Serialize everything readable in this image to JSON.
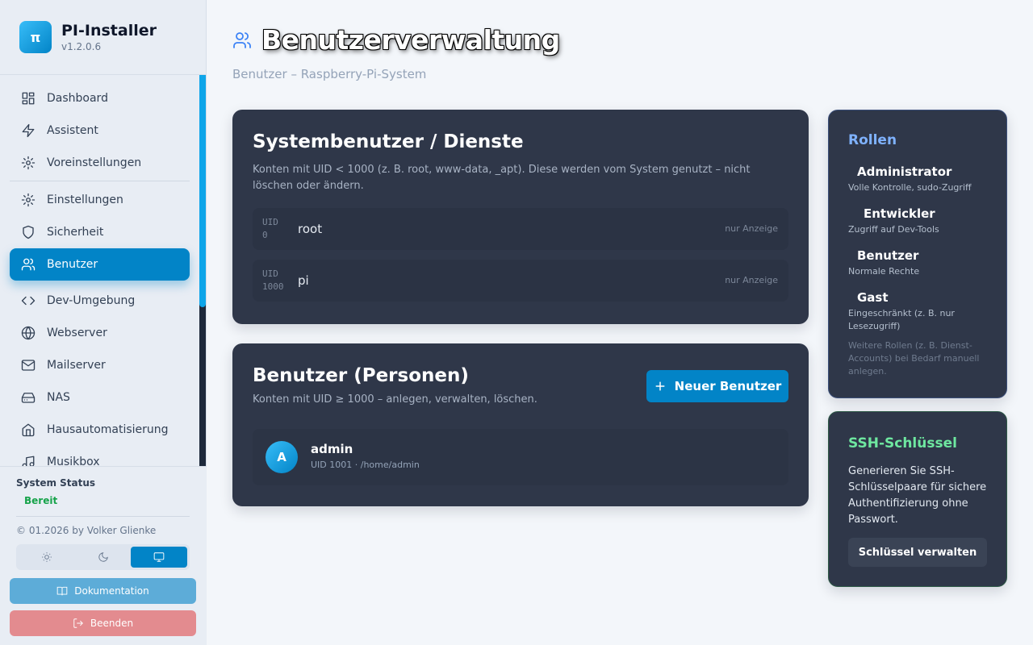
{
  "app": {
    "name": "PI-Installer",
    "version": "v1.2.0.6",
    "logo_glyph": "π"
  },
  "nav": [
    {
      "label": "Dashboard",
      "icon": "dashboard-icon"
    },
    {
      "label": "Assistent",
      "icon": "lightning-icon"
    },
    {
      "label": "Voreinstellungen",
      "icon": "gear-icon"
    },
    {
      "label": "Einstellungen",
      "icon": "gear-icon"
    },
    {
      "label": "Sicherheit",
      "icon": "shield-icon"
    },
    {
      "label": "Benutzer",
      "icon": "users-icon",
      "active": true
    },
    {
      "label": "Dev-Umgebung",
      "icon": "code-icon"
    },
    {
      "label": "Webserver",
      "icon": "globe-icon"
    },
    {
      "label": "Mailserver",
      "icon": "mail-icon"
    },
    {
      "label": "NAS",
      "icon": "hard-drive-icon"
    },
    {
      "label": "Hausautomatisierung",
      "icon": "home-icon"
    },
    {
      "label": "Musikbox",
      "icon": "music-icon"
    }
  ],
  "status": {
    "title": "System Status",
    "value": "Bereit",
    "value_color": "#16a34a"
  },
  "footer": {
    "copyright": "© 01.2026 by Volker Glienke",
    "doc_label": "Dokumentation",
    "exit_label": "Beenden"
  },
  "theme": {
    "options": [
      "light",
      "dark",
      "system"
    ],
    "selected": "system"
  },
  "page": {
    "title": "Benutzerverwaltung",
    "subtitle": "Benutzer – Raspberry-Pi-System"
  },
  "system_users": {
    "title": "Systembenutzer / Dienste",
    "description": "Konten mit UID < 1000 (z. B. root, www-data, _apt). Diese werden vom System genutzt – nicht löschen oder ändern.",
    "uid_label": "UID",
    "rows": [
      {
        "uid": "0",
        "name": "root",
        "note": "nur Anzeige"
      },
      {
        "uid": "1000",
        "name": "pi",
        "note": "nur Anzeige"
      }
    ]
  },
  "persons": {
    "title": "Benutzer (Personen)",
    "description": "Konten mit UID ≥ 1000 – anlegen, verwalten, löschen.",
    "new_button": "Neuer Benutzer",
    "users": [
      {
        "initial": "A",
        "name": "admin",
        "meta": "UID 1001 · /home/admin"
      }
    ]
  },
  "roles": {
    "title": "Rollen",
    "items": [
      {
        "name": "Administrator",
        "desc": "Volle Kontrolle, sudo-Zugriff"
      },
      {
        "name": "Entwickler",
        "desc": "Zugriff auf Dev-Tools"
      },
      {
        "name": "Benutzer",
        "desc": "Normale Rechte"
      },
      {
        "name": "Gast",
        "desc": "Eingeschränkt (z. B. nur Lesezugriff)"
      }
    ],
    "note": "Weitere Rollen (z. B. Dienst-Accounts) bei Bedarf manuell anlegen."
  },
  "ssh": {
    "title": "SSH-Schlüssel",
    "description": "Generieren Sie SSH-Schlüsselpaare für sichere Authentifizierung ohne Passwort.",
    "button": "Schlüssel verwalten"
  },
  "colors": {
    "accent": "#0284c7",
    "card_bg": "#2f3749",
    "roles_title": "#7fb2ff",
    "ssh_title": "#6ee7a0"
  }
}
